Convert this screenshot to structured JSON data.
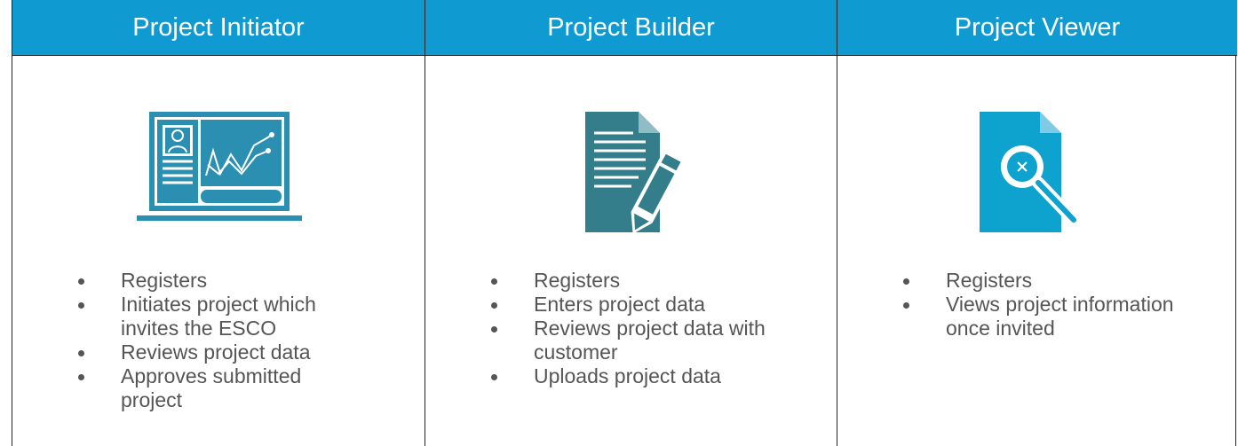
{
  "colors": {
    "header_bg": "#0f9ad2",
    "initiator_icon": "#2b8fb1",
    "builder_icon": "#347e8c",
    "viewer_icon": "#0ea2cf"
  },
  "columns": [
    {
      "title": "Project Initiator",
      "icon": "laptop-dashboard-icon",
      "bullets": [
        "Registers",
        "Initiates project which invites the ESCO",
        "Reviews project data",
        "Approves submitted project"
      ]
    },
    {
      "title": "Project Builder",
      "icon": "document-pencil-icon",
      "bullets": [
        "Registers",
        "Enters project data",
        "Reviews project data with customer",
        "Uploads project data"
      ]
    },
    {
      "title": "Project Viewer",
      "icon": "document-magnifier-icon",
      "bullets": [
        "Registers",
        "Views project information once invited"
      ]
    }
  ]
}
